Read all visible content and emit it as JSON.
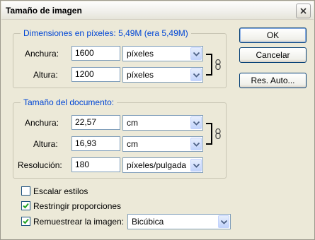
{
  "window": {
    "title": "Tamaño de imagen"
  },
  "pixels_group": {
    "legend": "Dimensiones en píxeles: 5,49M (era 5,49M)",
    "width_label": "Anchura:",
    "width_value": "1600",
    "width_unit": "píxeles",
    "height_label": "Altura:",
    "height_value": "1200",
    "height_unit": "píxeles"
  },
  "doc_group": {
    "legend": "Tamaño del documento:",
    "width_label": "Anchura:",
    "width_value": "22,57",
    "width_unit": "cm",
    "height_label": "Altura:",
    "height_value": "16,93",
    "height_unit": "cm",
    "resolution_label": "Resolución:",
    "resolution_value": "180",
    "resolution_unit": "píxeles/pulgada"
  },
  "buttons": {
    "ok": "OK",
    "cancel": "Cancelar",
    "auto": "Res. Auto..."
  },
  "options": {
    "scale_styles": {
      "label": "Escalar estilos",
      "checked": false
    },
    "constrain": {
      "label": "Restringir proporciones",
      "checked": true
    },
    "resample": {
      "label": "Remuestrear la imagen:",
      "checked": true,
      "method": "Bicúbica"
    }
  }
}
